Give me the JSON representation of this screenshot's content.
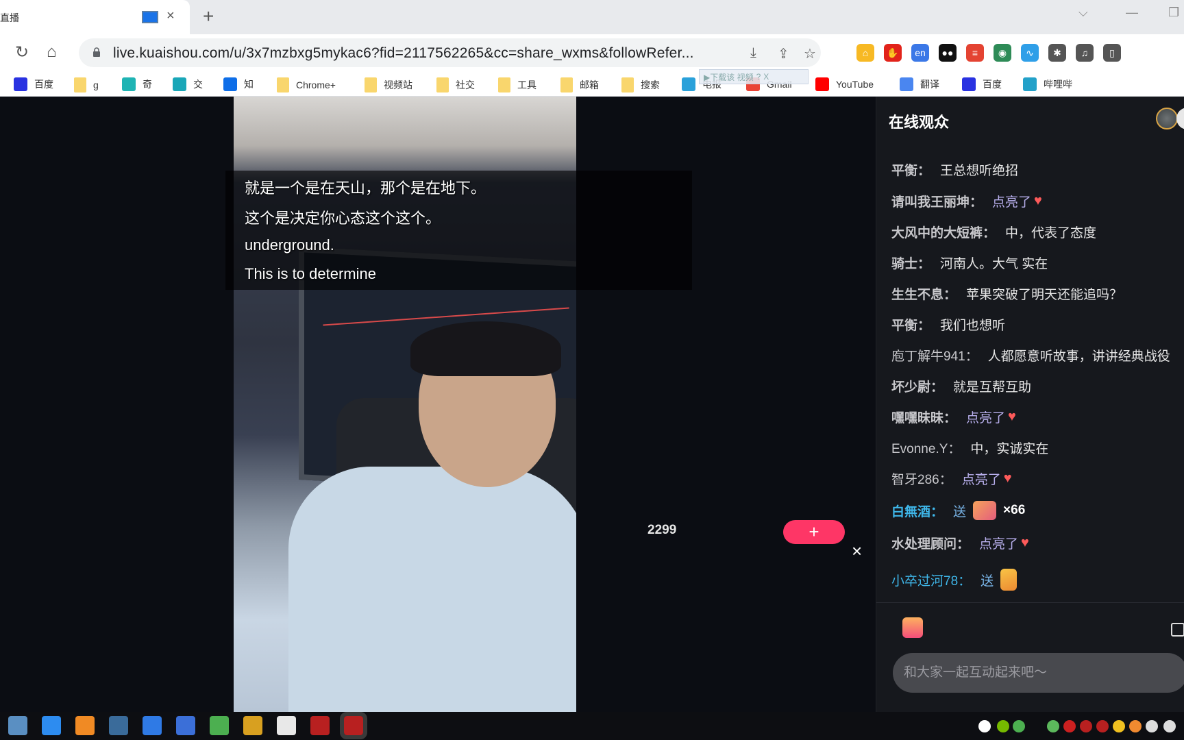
{
  "browser": {
    "tab_title": "直播",
    "new_tab_label": "+",
    "tab_close": "×",
    "url": "live.kuaishou.com/u/3x7mzbxg5mykac6?fid=2117562265&cc=share_wxms&followRefer...",
    "window_controls": {
      "dropdown": "⌵",
      "minimize": "—",
      "restore": "❐"
    },
    "nav": {
      "reload": "↻",
      "home": "⌂"
    },
    "omnibox_icons": {
      "install": "⤓",
      "share": "⇪",
      "bookmark": "☆"
    },
    "extensions": [
      {
        "name": "google-home-ext-icon",
        "glyph": "⌂",
        "color": "#f7b924"
      },
      {
        "name": "adblock-ext-icon",
        "glyph": "✋",
        "color": "#e2231a"
      },
      {
        "name": "translate-ext-icon",
        "glyph": "en",
        "color": "#3b78e7"
      },
      {
        "name": "tampermonkey-ext-icon",
        "glyph": "●●",
        "color": "#111111"
      },
      {
        "name": "todoist-ext-icon",
        "glyph": "≡",
        "color": "#e44332"
      },
      {
        "name": "idm-ext-icon",
        "glyph": "◉",
        "color": "#2e8b57"
      },
      {
        "name": "blue-ext-icon",
        "glyph": "∿",
        "color": "#2f9fe8"
      },
      {
        "name": "extensions-puzzle-icon",
        "glyph": "✱",
        "color": "#555555"
      },
      {
        "name": "media-control-icon",
        "glyph": "♫",
        "color": "#555555"
      },
      {
        "name": "side-panel-icon",
        "glyph": "▯",
        "color": "#555555"
      }
    ],
    "bookmarks": [
      {
        "label": "百度",
        "icon": "baidu-icon"
      },
      {
        "label": "g",
        "icon": "folder-icon"
      },
      {
        "label": "奇",
        "icon": "qi-icon"
      },
      {
        "label": "交",
        "icon": "jiao-icon"
      },
      {
        "label": "知",
        "icon": "zhihu-icon"
      },
      {
        "label": "Chrome+",
        "icon": "folder-icon"
      },
      {
        "label": "视频站",
        "icon": "folder-icon"
      },
      {
        "label": "社交",
        "icon": "folder-icon"
      },
      {
        "label": "工具",
        "icon": "folder-icon"
      },
      {
        "label": "邮箱",
        "icon": "folder-icon"
      },
      {
        "label": "搜索",
        "icon": "folder-icon"
      },
      {
        "label": "电报",
        "icon": "telegram-icon"
      },
      {
        "label": "Gmail",
        "icon": "gmail-icon"
      },
      {
        "label": "YouTube",
        "icon": "youtube-icon"
      },
      {
        "label": "翻译",
        "icon": "google-translate-icon"
      },
      {
        "label": "百度",
        "icon": "baidu-icon"
      },
      {
        "label": "哔哩哔",
        "icon": "bilibili-icon"
      }
    ],
    "download_float": {
      "label": "▶下载该 视频",
      "help": "?",
      "close": "X"
    }
  },
  "player": {
    "subtitles": [
      "就是一个是在天山，那个是在地下。",
      "这个是决定你心态这个这个。",
      "underground.",
      "This is to determine"
    ],
    "viewer_count": "2299",
    "follow_label": "+",
    "close_label": "×"
  },
  "chat": {
    "title": "在线观众",
    "messages": [
      {
        "user": "平衡：",
        "text": "王总想听绝招",
        "type": "text"
      },
      {
        "user": "请叫我王丽坤：",
        "text": "点亮了",
        "type": "like"
      },
      {
        "user": "大风中的大短裤：",
        "text": "中，代表了态度",
        "type": "text"
      },
      {
        "user": "骑士：",
        "text": "河南人。大气 实在",
        "type": "text"
      },
      {
        "user": "生生不息：",
        "text": "苹果突破了明天还能追吗？",
        "type": "text"
      },
      {
        "user": "平衡：",
        "text": "我们也想听",
        "type": "text"
      },
      {
        "user": "庖丁解牛941：",
        "text": "人都愿意听故事，讲讲经典战役",
        "type": "text"
      },
      {
        "user": "坏少尉：",
        "text": "就是互帮互助",
        "type": "text"
      },
      {
        "user": "嘿嘿昧昧：",
        "text": "点亮了",
        "type": "like"
      },
      {
        "user": "Evonne.Y：",
        "text": "中，实诚实在",
        "type": "text"
      },
      {
        "user": "智牙286：",
        "text": "点亮了",
        "type": "like"
      },
      {
        "user": "白無酒：",
        "text": "送",
        "type": "gift",
        "count": "×66"
      },
      {
        "user": "水处理顾问：",
        "text": "点亮了",
        "type": "like"
      },
      {
        "user": "小卒过河78：",
        "text": "送",
        "type": "gift-card"
      }
    ],
    "input_placeholder": "和大家一起互动起来吧～",
    "heart_glyph": "♥"
  },
  "taskbar": {
    "apps": [
      "photo-viewer",
      "feishu",
      "search-tool",
      "game",
      "sogou",
      "search-magnifier",
      "chrome",
      "trading-app",
      "file-explorer",
      "wh6-app",
      "wh6-app-active"
    ],
    "tray": [
      "p-app",
      "nvidia",
      "chrome",
      "sync",
      "record",
      "wh6",
      "wh6",
      "security",
      "orange-app",
      "network",
      "volume"
    ]
  },
  "colors": {
    "accent_follow": "#fe3666",
    "vip_name": "#3fb7ea",
    "like_text": "#b9b0ee",
    "heart": "#fd5a5a"
  }
}
